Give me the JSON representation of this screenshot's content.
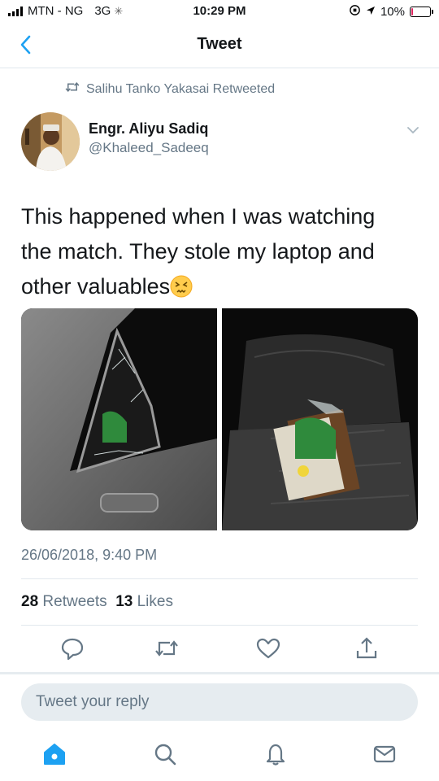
{
  "status_bar": {
    "carrier": "MTN - NG",
    "network": "3G",
    "time": "10:29 PM",
    "battery": "10%",
    "battery_level": 0.1,
    "battery_color": "#e0245e"
  },
  "nav": {
    "back_icon": "chevron-left-icon",
    "title": "Tweet"
  },
  "retweet_banner": {
    "icon": "retweet-icon",
    "text": "Salihu Tanko Yakasai Retweeted"
  },
  "tweet": {
    "author_name": "Engr. Aliyu Sadiq",
    "author_handle": "@Khaleed_Sadeeq",
    "text_line1": "This happened when I was watching",
    "text_line2": "the match. They stole my laptop and",
    "text_line3": "other valuables",
    "emoji": "persevering-face-emoji",
    "timestamp": "26/06/2018, 9:40 PM",
    "retweets_count": "28",
    "retweets_label": "Retweets",
    "likes_count": "13",
    "likes_label": "Likes",
    "photos": [
      "broken-car-window-photo",
      "car-back-seat-photo"
    ]
  },
  "actions": [
    "reply-icon",
    "retweet-icon",
    "like-icon",
    "share-icon"
  ],
  "reply": {
    "placeholder": "Tweet your reply"
  },
  "tab_bar": [
    "home-icon",
    "search-icon",
    "notifications-icon",
    "messages-icon"
  ],
  "colors": {
    "accent": "#1da1f2",
    "secondary_text": "#657786",
    "primary_text": "#14171a",
    "divider": "#e1e8ed"
  }
}
